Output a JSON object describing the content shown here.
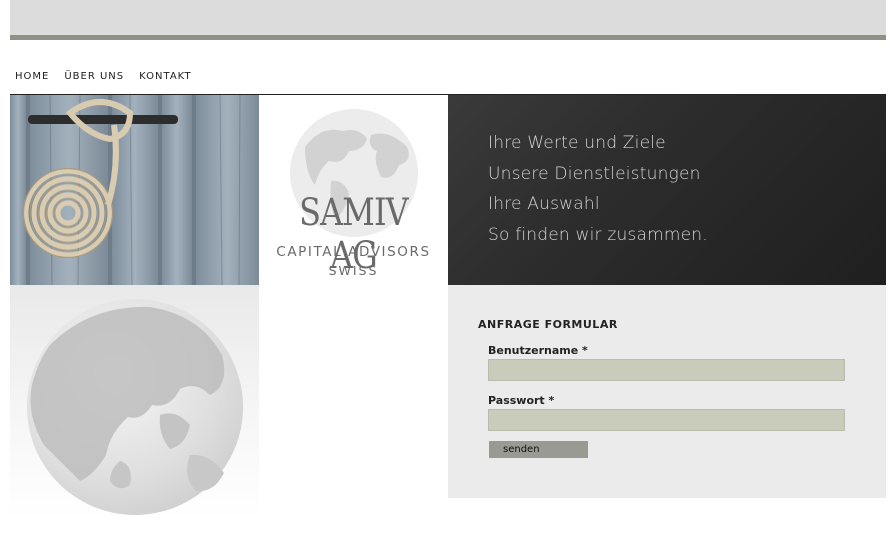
{
  "nav": {
    "items": [
      {
        "label": "HOME"
      },
      {
        "label": "ÜBER UNS"
      },
      {
        "label": "KONTAKT"
      }
    ]
  },
  "logo": {
    "name": "SAMIV AG",
    "subtitle": "CAPITAL ADVISORS",
    "country": "SWISS"
  },
  "banner": {
    "lines": [
      "Ihre Werte und Ziele",
      "Unsere Dienstleistungen",
      "Ihre Auswahl",
      "So finden wir zusammen."
    ]
  },
  "form": {
    "title": "ANFRAGE FORMULAR",
    "username_label": "Benutzername *",
    "username_value": "",
    "password_label": "Passwort *",
    "password_value": "",
    "submit_label": "senden"
  },
  "colors": {
    "top_bar": "#dcdcdc",
    "rule": "#8f9287",
    "dark_panel": "#2b2b2b",
    "input_bg": "#c9ccba",
    "button_bg": "#999b92"
  }
}
